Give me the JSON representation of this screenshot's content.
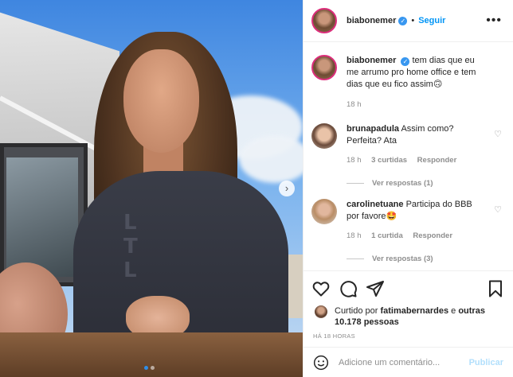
{
  "post": {
    "username": "biabonemer",
    "follow_label": "Seguir",
    "more_label": "•••",
    "caption": "tem dias que eu me arrumo pro home office e tem dias que eu fico assim",
    "caption_emoji": "🙃",
    "caption_time": "18 h"
  },
  "comments": [
    {
      "username": "brunapadula",
      "text": "Assim como? Perfeita? Ata",
      "time": "18 h",
      "likes": "3 curtidas",
      "reply_label": "Responder",
      "view_replies": "Ver respostas (1)"
    },
    {
      "username": "carolinetuane",
      "text": "Participa do BBB por favore",
      "emoji": "🤩",
      "time": "18 h",
      "likes": "1 curtida",
      "reply_label": "Responder",
      "view_replies": "Ver respostas (3)"
    }
  ],
  "likes_summary": {
    "prefix": "Curtido por",
    "user": "fatimabernardes",
    "middle": "e",
    "others": "outras 10.178 pessoas"
  },
  "posted_ago": "HÁ 18 HORAS",
  "add_comment": {
    "placeholder": "Adicione um comentário...",
    "post_label": "Publicar"
  },
  "carousel": {
    "next_label": "›",
    "slide_count": 2,
    "active_index": 0
  },
  "colors": {
    "accent": "#0095f6",
    "verified": "#3897f0",
    "ring": "#dc2e7b"
  },
  "icons": [
    "verified-badge-icon",
    "more-options-icon",
    "heart-icon",
    "comment-icon",
    "share-icon",
    "bookmark-icon",
    "emoji-icon",
    "next-arrow-icon"
  ]
}
